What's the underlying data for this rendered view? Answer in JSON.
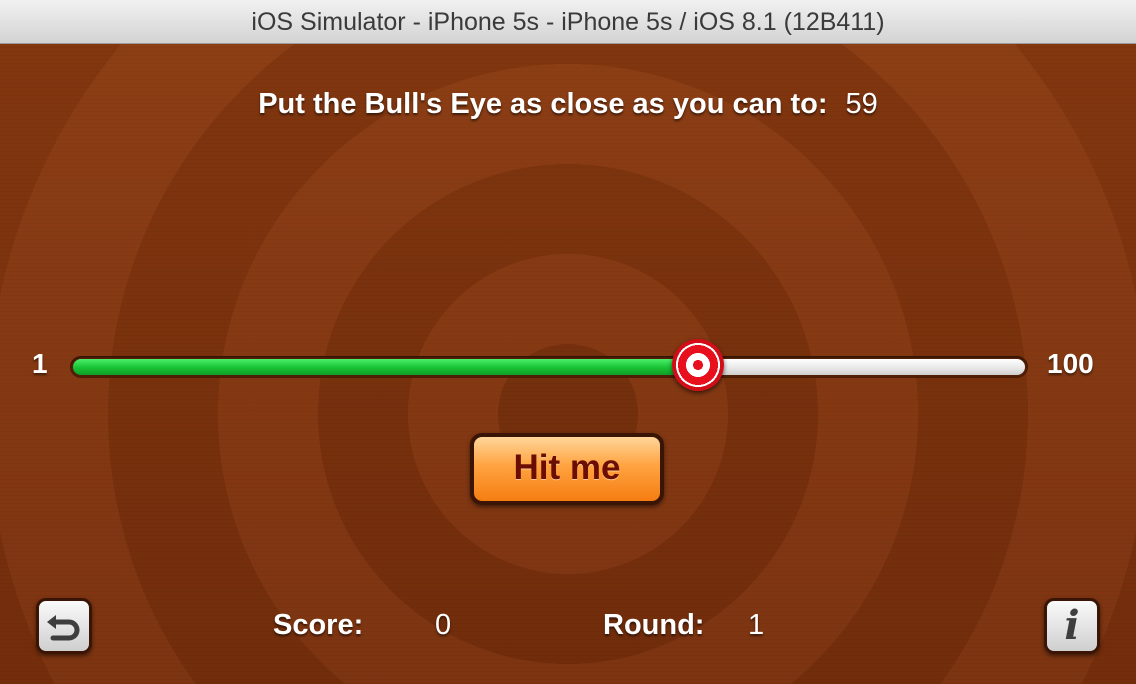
{
  "window": {
    "title": "iOS Simulator - iPhone 5s - iPhone 5s / iOS 8.1 (12B411)"
  },
  "game": {
    "prompt": "Put the Bull's Eye as close as you can to:",
    "target_value": "59",
    "slider": {
      "min_label": "1",
      "max_label": "100",
      "min": 1,
      "max": 100,
      "value": 66
    },
    "hit_button_label": "Hit me",
    "score_label": "Score:",
    "score_value": "0",
    "round_label": "Round:",
    "round_value": "1"
  },
  "icons": {
    "start_over": "undo-arrow-icon",
    "info": "info-icon"
  },
  "colors": {
    "background_wood": "#7a300c",
    "slider_fill": "#18c234",
    "slider_track": "#e6e6e6",
    "thumb_red": "#e6101e",
    "button_orange": "#ffa340",
    "button_text": "#6b0d02"
  }
}
